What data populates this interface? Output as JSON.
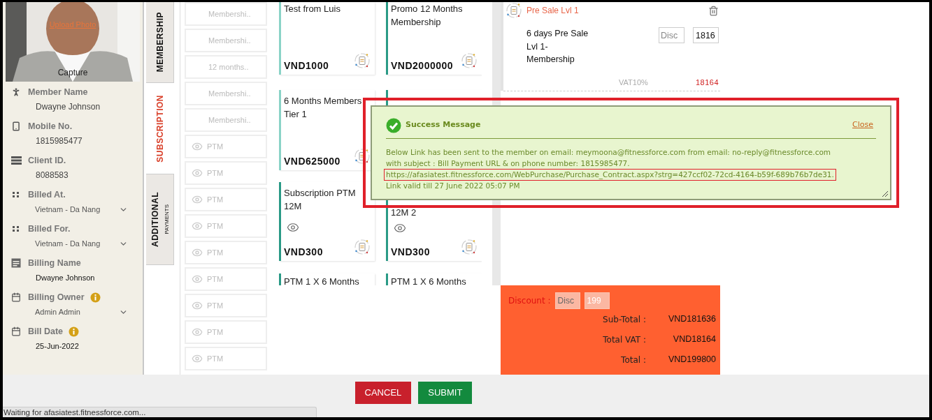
{
  "photo": {
    "upload_link": "Upload Photo",
    "capture_label": "Capture"
  },
  "member_fields": [
    {
      "kind": "text",
      "label": "Member Name",
      "value": "Dwayne Johnson",
      "info": false
    },
    {
      "kind": "text",
      "label": "Mobile No.",
      "value": "1815985477",
      "info": false
    },
    {
      "kind": "text",
      "label": "Client ID.",
      "value": "8088583",
      "info": false
    },
    {
      "kind": "select",
      "label": "Billed At.",
      "value": "Vietnam - Da Nang",
      "info": false
    },
    {
      "kind": "select",
      "label": "Billed For.",
      "value": "Vietnam - Da Nang",
      "info": false
    },
    {
      "kind": "strong",
      "label": "Billing Name",
      "value": "Dwayne  Johnson",
      "info": false
    },
    {
      "kind": "select",
      "label": "Billing Owner",
      "value": "Admin Admin",
      "info": true
    },
    {
      "kind": "strong",
      "label": "Bill Date",
      "value": "25-Jun-2022",
      "info": true
    }
  ],
  "tabs": [
    {
      "label": "MEMBERSHIP",
      "selected": false
    },
    {
      "label": "SUBSCRIPTION",
      "selected": true
    },
    {
      "label": "ADDITIONAL",
      "sublabel": "PAYMENTS",
      "selected": false
    }
  ],
  "plan_items": [
    {
      "kind": "plain",
      "label": "Membershi.."
    },
    {
      "kind": "plain",
      "label": "Membershi.."
    },
    {
      "kind": "plain",
      "label": "12 months.."
    },
    {
      "kind": "plain",
      "label": "Membershi.."
    },
    {
      "kind": "plain",
      "label": "Membershi.."
    },
    {
      "kind": "eye",
      "label": "PTM"
    },
    {
      "kind": "eye",
      "label": "PTM"
    },
    {
      "kind": "eye",
      "label": "PTM"
    },
    {
      "kind": "eye",
      "label": "PTM"
    },
    {
      "kind": "eye",
      "label": "PTM"
    },
    {
      "kind": "eye",
      "label": "PTM"
    },
    {
      "kind": "eye",
      "label": "PTM"
    },
    {
      "kind": "eye",
      "label": "PTM"
    },
    {
      "kind": "eye",
      "label": "PTM"
    }
  ],
  "cards": [
    {
      "kind": "full",
      "lines": [
        "Test from Luis"
      ],
      "price": "VND1000",
      "color": "#8ad3c7"
    },
    {
      "kind": "full",
      "lines": [
        "Promo 12 Months",
        "Membership"
      ],
      "price": "VND2000000",
      "color": "#2a9a86"
    },
    {
      "kind": "full",
      "lines": [
        "6 Months Members",
        "Tier 1"
      ],
      "price": "VND625000",
      "color": "#8ad3c7"
    },
    {
      "kind": "covered",
      "color": "#2a9a86"
    },
    {
      "kind": "eye",
      "lines": [
        "Subscription PTM",
        "12M"
      ],
      "price": "VND300",
      "color": "#2a9a86"
    },
    {
      "kind": "continued",
      "lines": [
        "12M 2"
      ],
      "price": "VND300",
      "color": "#2a9a86"
    },
    {
      "kind": "tail",
      "lines": [
        "PTM 1 X 6 Months"
      ],
      "color": "#2a9a86"
    },
    {
      "kind": "tail",
      "lines": [
        "PTM 1 X 6 Months"
      ],
      "color": "#2a9a86"
    }
  ],
  "cart_item": {
    "title": "Pre Sale Lvl 1",
    "name_lines": [
      "6 days Pre Sale",
      "Lvl 1-",
      "Membership"
    ],
    "discount_placeholder": "Disc",
    "amount": "1816",
    "vat_label": "VAT10%",
    "vat_amount": "18164"
  },
  "summary": {
    "discount_label": "Discount :",
    "discount_placeholder": "Disc",
    "discount_value": "199",
    "rows": [
      {
        "label": "Sub-Total :",
        "value": "VND181636"
      },
      {
        "label": "Total VAT :",
        "value": "VND18164"
      },
      {
        "label": "Total :",
        "value": "VND199800"
      }
    ]
  },
  "buttons": [
    {
      "kind": "cancel",
      "label": "CANCEL"
    },
    {
      "kind": "submit",
      "label": "SUBMIT"
    }
  ],
  "status_bar": "Waiting for afasiatest.fitnessforce.com...",
  "success_dialog": {
    "title": "Success Message",
    "close_link": "Close",
    "message": "Below Link has been sent to the member on email: meymoona@fitnessforce.com from email: no-reply@fitnessforce.com with subject : Bill Payment URL & on phone number: 1815985477.",
    "url": "https://afasiatest.fitnessforce.com/WebPurchase/Purchase_Contract.aspx?strg=427ccf02-72cd-4164-b59f-689b76b7de31.",
    "validity": "Link valid till 27 June 2022 05:07 PM"
  }
}
